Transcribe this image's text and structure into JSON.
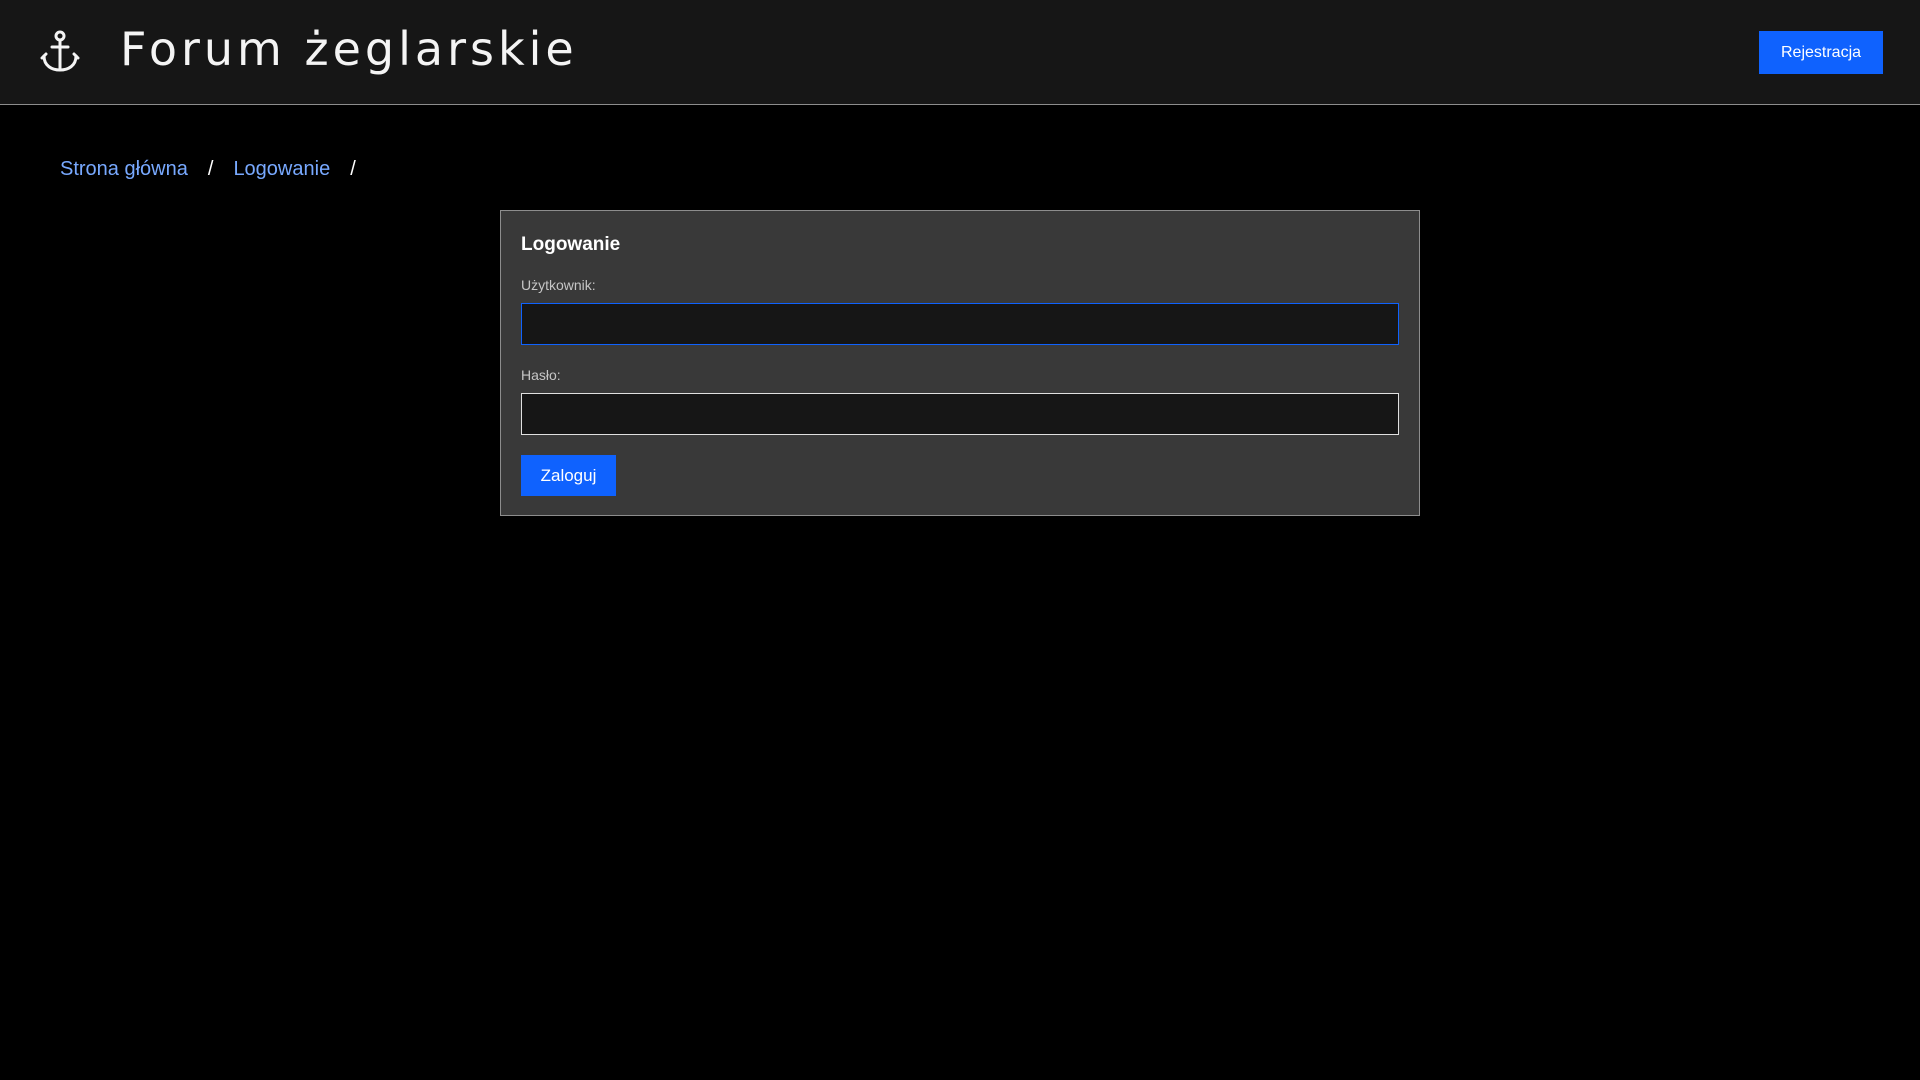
{
  "header": {
    "logo_icon": "anchor-icon",
    "title": "Forum żeglarskie",
    "register_label": "Rejestracja"
  },
  "breadcrumb": {
    "items": [
      {
        "label": "Strona główna"
      },
      {
        "label": "Logowanie"
      }
    ],
    "separator": "/"
  },
  "login_form": {
    "title": "Logowanie",
    "username_label": "Użytkownik:",
    "username_value": "",
    "password_label": "Hasło:",
    "password_value": "",
    "submit_label": "Zaloguj"
  },
  "colors": {
    "background": "#000000",
    "header_bg": "#161616",
    "accent": "#0f62fe",
    "link": "#78a9ff",
    "panel_bg": "#393939"
  }
}
